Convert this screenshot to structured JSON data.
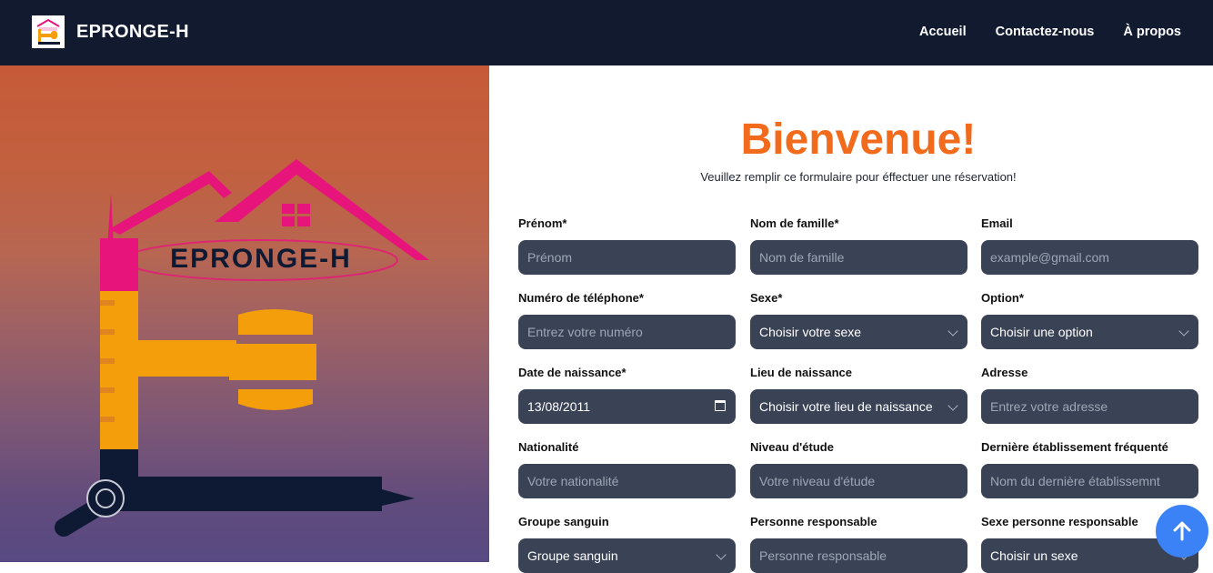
{
  "navbar": {
    "brand_name": "EPRONGE-H",
    "links": [
      "Accueil",
      "Contactez-nous",
      "À propos"
    ]
  },
  "hero": {
    "logo_text": "EPRONGE-H"
  },
  "form": {
    "title": "Bienvenue!",
    "subtitle": "Veuillez remplir ce formulaire pour éffectuer une réservation!",
    "fields": [
      {
        "label": "Prénom*",
        "placeholder": "Prénom"
      },
      {
        "label": "Nom de famille*",
        "placeholder": "Nom de famille"
      },
      {
        "label": "Email",
        "placeholder": "example@gmail.com"
      },
      {
        "label": "Numéro de téléphone*",
        "placeholder": "Entrez votre numéro"
      },
      {
        "label": "Sexe*",
        "value": "Choisir votre sexe"
      },
      {
        "label": "Option*",
        "value": "Choisir une option"
      },
      {
        "label": "Date de naissance*",
        "value": "13/08/2011"
      },
      {
        "label": "Lieu de naissance",
        "value": "Choisir votre lieu de naissance"
      },
      {
        "label": "Adresse",
        "placeholder": "Entrez votre adresse"
      },
      {
        "label": "Nationalité",
        "placeholder": "Votre nationalité"
      },
      {
        "label": "Niveau d'étude",
        "placeholder": "Votre niveau d'étude"
      },
      {
        "label": "Dernière établissement fréquenté",
        "placeholder": "Nom du dernière établissemnt"
      },
      {
        "label": "Groupe sanguin",
        "value": "Groupe sanguin"
      },
      {
        "label": "Personne responsable",
        "placeholder": "Personne responsable"
      },
      {
        "label": "Sexe personne responsable",
        "value": "Choisir un sexe"
      }
    ]
  },
  "icons": {
    "scroll_top": "arrow-up-icon",
    "select": "chevron-down-icon",
    "date": "calendar-icon"
  },
  "colors": {
    "navbar": "#111a2e",
    "title": "#f26a1b",
    "input_bg": "#3a4356",
    "scroll_button": "#3b82f6"
  }
}
